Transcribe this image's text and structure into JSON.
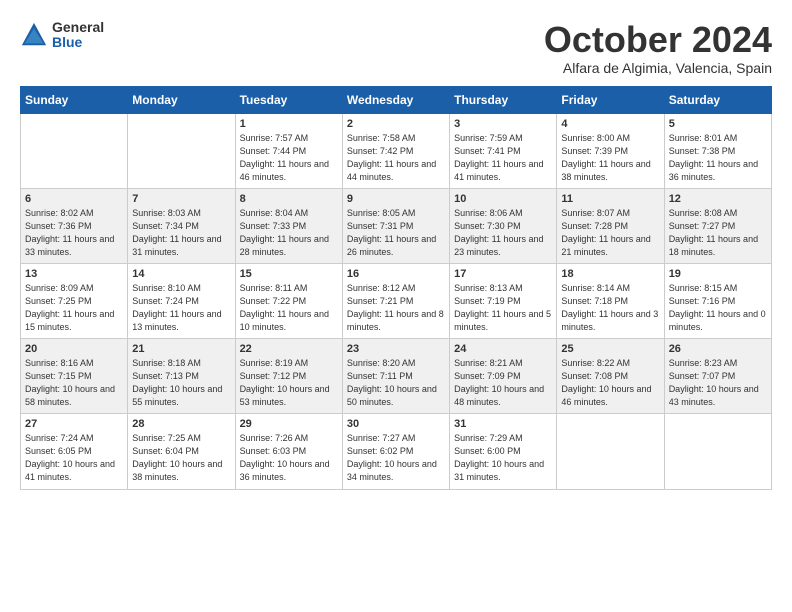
{
  "header": {
    "logo_general": "General",
    "logo_blue": "Blue",
    "month_title": "October 2024",
    "location": "Alfara de Algimia, Valencia, Spain"
  },
  "calendar": {
    "weekdays": [
      "Sunday",
      "Monday",
      "Tuesday",
      "Wednesday",
      "Thursday",
      "Friday",
      "Saturday"
    ],
    "weeks": [
      [
        {
          "day": "",
          "info": ""
        },
        {
          "day": "",
          "info": ""
        },
        {
          "day": "1",
          "info": "Sunrise: 7:57 AM\nSunset: 7:44 PM\nDaylight: 11 hours and 46 minutes."
        },
        {
          "day": "2",
          "info": "Sunrise: 7:58 AM\nSunset: 7:42 PM\nDaylight: 11 hours and 44 minutes."
        },
        {
          "day": "3",
          "info": "Sunrise: 7:59 AM\nSunset: 7:41 PM\nDaylight: 11 hours and 41 minutes."
        },
        {
          "day": "4",
          "info": "Sunrise: 8:00 AM\nSunset: 7:39 PM\nDaylight: 11 hours and 38 minutes."
        },
        {
          "day": "5",
          "info": "Sunrise: 8:01 AM\nSunset: 7:38 PM\nDaylight: 11 hours and 36 minutes."
        }
      ],
      [
        {
          "day": "6",
          "info": "Sunrise: 8:02 AM\nSunset: 7:36 PM\nDaylight: 11 hours and 33 minutes."
        },
        {
          "day": "7",
          "info": "Sunrise: 8:03 AM\nSunset: 7:34 PM\nDaylight: 11 hours and 31 minutes."
        },
        {
          "day": "8",
          "info": "Sunrise: 8:04 AM\nSunset: 7:33 PM\nDaylight: 11 hours and 28 minutes."
        },
        {
          "day": "9",
          "info": "Sunrise: 8:05 AM\nSunset: 7:31 PM\nDaylight: 11 hours and 26 minutes."
        },
        {
          "day": "10",
          "info": "Sunrise: 8:06 AM\nSunset: 7:30 PM\nDaylight: 11 hours and 23 minutes."
        },
        {
          "day": "11",
          "info": "Sunrise: 8:07 AM\nSunset: 7:28 PM\nDaylight: 11 hours and 21 minutes."
        },
        {
          "day": "12",
          "info": "Sunrise: 8:08 AM\nSunset: 7:27 PM\nDaylight: 11 hours and 18 minutes."
        }
      ],
      [
        {
          "day": "13",
          "info": "Sunrise: 8:09 AM\nSunset: 7:25 PM\nDaylight: 11 hours and 15 minutes."
        },
        {
          "day": "14",
          "info": "Sunrise: 8:10 AM\nSunset: 7:24 PM\nDaylight: 11 hours and 13 minutes."
        },
        {
          "day": "15",
          "info": "Sunrise: 8:11 AM\nSunset: 7:22 PM\nDaylight: 11 hours and 10 minutes."
        },
        {
          "day": "16",
          "info": "Sunrise: 8:12 AM\nSunset: 7:21 PM\nDaylight: 11 hours and 8 minutes."
        },
        {
          "day": "17",
          "info": "Sunrise: 8:13 AM\nSunset: 7:19 PM\nDaylight: 11 hours and 5 minutes."
        },
        {
          "day": "18",
          "info": "Sunrise: 8:14 AM\nSunset: 7:18 PM\nDaylight: 11 hours and 3 minutes."
        },
        {
          "day": "19",
          "info": "Sunrise: 8:15 AM\nSunset: 7:16 PM\nDaylight: 11 hours and 0 minutes."
        }
      ],
      [
        {
          "day": "20",
          "info": "Sunrise: 8:16 AM\nSunset: 7:15 PM\nDaylight: 10 hours and 58 minutes."
        },
        {
          "day": "21",
          "info": "Sunrise: 8:18 AM\nSunset: 7:13 PM\nDaylight: 10 hours and 55 minutes."
        },
        {
          "day": "22",
          "info": "Sunrise: 8:19 AM\nSunset: 7:12 PM\nDaylight: 10 hours and 53 minutes."
        },
        {
          "day": "23",
          "info": "Sunrise: 8:20 AM\nSunset: 7:11 PM\nDaylight: 10 hours and 50 minutes."
        },
        {
          "day": "24",
          "info": "Sunrise: 8:21 AM\nSunset: 7:09 PM\nDaylight: 10 hours and 48 minutes."
        },
        {
          "day": "25",
          "info": "Sunrise: 8:22 AM\nSunset: 7:08 PM\nDaylight: 10 hours and 46 minutes."
        },
        {
          "day": "26",
          "info": "Sunrise: 8:23 AM\nSunset: 7:07 PM\nDaylight: 10 hours and 43 minutes."
        }
      ],
      [
        {
          "day": "27",
          "info": "Sunrise: 7:24 AM\nSunset: 6:05 PM\nDaylight: 10 hours and 41 minutes."
        },
        {
          "day": "28",
          "info": "Sunrise: 7:25 AM\nSunset: 6:04 PM\nDaylight: 10 hours and 38 minutes."
        },
        {
          "day": "29",
          "info": "Sunrise: 7:26 AM\nSunset: 6:03 PM\nDaylight: 10 hours and 36 minutes."
        },
        {
          "day": "30",
          "info": "Sunrise: 7:27 AM\nSunset: 6:02 PM\nDaylight: 10 hours and 34 minutes."
        },
        {
          "day": "31",
          "info": "Sunrise: 7:29 AM\nSunset: 6:00 PM\nDaylight: 10 hours and 31 minutes."
        },
        {
          "day": "",
          "info": ""
        },
        {
          "day": "",
          "info": ""
        }
      ]
    ]
  }
}
